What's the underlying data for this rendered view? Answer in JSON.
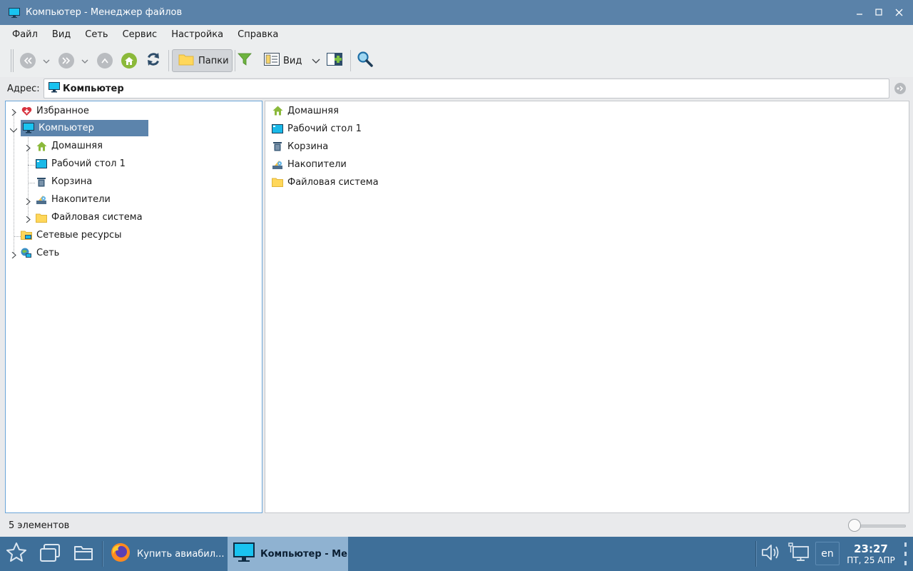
{
  "window": {
    "title": "Компьютер - Менеджер файлов"
  },
  "menubar": {
    "items": [
      "Файл",
      "Вид",
      "Сеть",
      "Сервис",
      "Настройка",
      "Справка"
    ]
  },
  "toolbar": {
    "folders_label": "Папки",
    "view_label": "Вид"
  },
  "address": {
    "label": "Адрес:",
    "value": "Компьютер"
  },
  "tree": {
    "items": [
      {
        "label": "Избранное",
        "icon": "favorites-heart-icon"
      },
      {
        "label": "Компьютер",
        "icon": "computer-icon",
        "selected": true
      },
      {
        "label": "Домашняя",
        "icon": "home-icon"
      },
      {
        "label": "Рабочий стол 1",
        "icon": "desktop-icon"
      },
      {
        "label": "Корзина",
        "icon": "trash-icon"
      },
      {
        "label": "Накопители",
        "icon": "drives-icon"
      },
      {
        "label": "Файловая система",
        "icon": "folder-icon"
      },
      {
        "label": "Сетевые ресурсы",
        "icon": "network-share-icon"
      },
      {
        "label": "Сеть",
        "icon": "network-globe-icon"
      }
    ]
  },
  "list": {
    "items": [
      {
        "label": "Домашняя",
        "icon": "home-icon"
      },
      {
        "label": "Рабочий стол 1",
        "icon": "desktop-icon"
      },
      {
        "label": "Корзина",
        "icon": "trash-icon"
      },
      {
        "label": "Накопители",
        "icon": "drives-icon"
      },
      {
        "label": "Файловая система",
        "icon": "folder-icon"
      }
    ]
  },
  "status": {
    "count_text": "5 элементов"
  },
  "taskbar": {
    "tasks": [
      {
        "label": "Купить авиабил...",
        "icon": "firefox-icon",
        "active": false
      },
      {
        "label": "Компьютер - Ме...",
        "icon": "computer-icon",
        "active": true
      }
    ],
    "language": "en",
    "time": "23:27",
    "date": "ПТ, 25 АПР"
  },
  "colors": {
    "titlebar": "#5a82a9",
    "selection": "#5c84ac",
    "taskbar": "#3e6f99",
    "active_task": "#8fb2d1",
    "home_green": "#8bb93a",
    "folder_yellow": "#ffd75a"
  }
}
